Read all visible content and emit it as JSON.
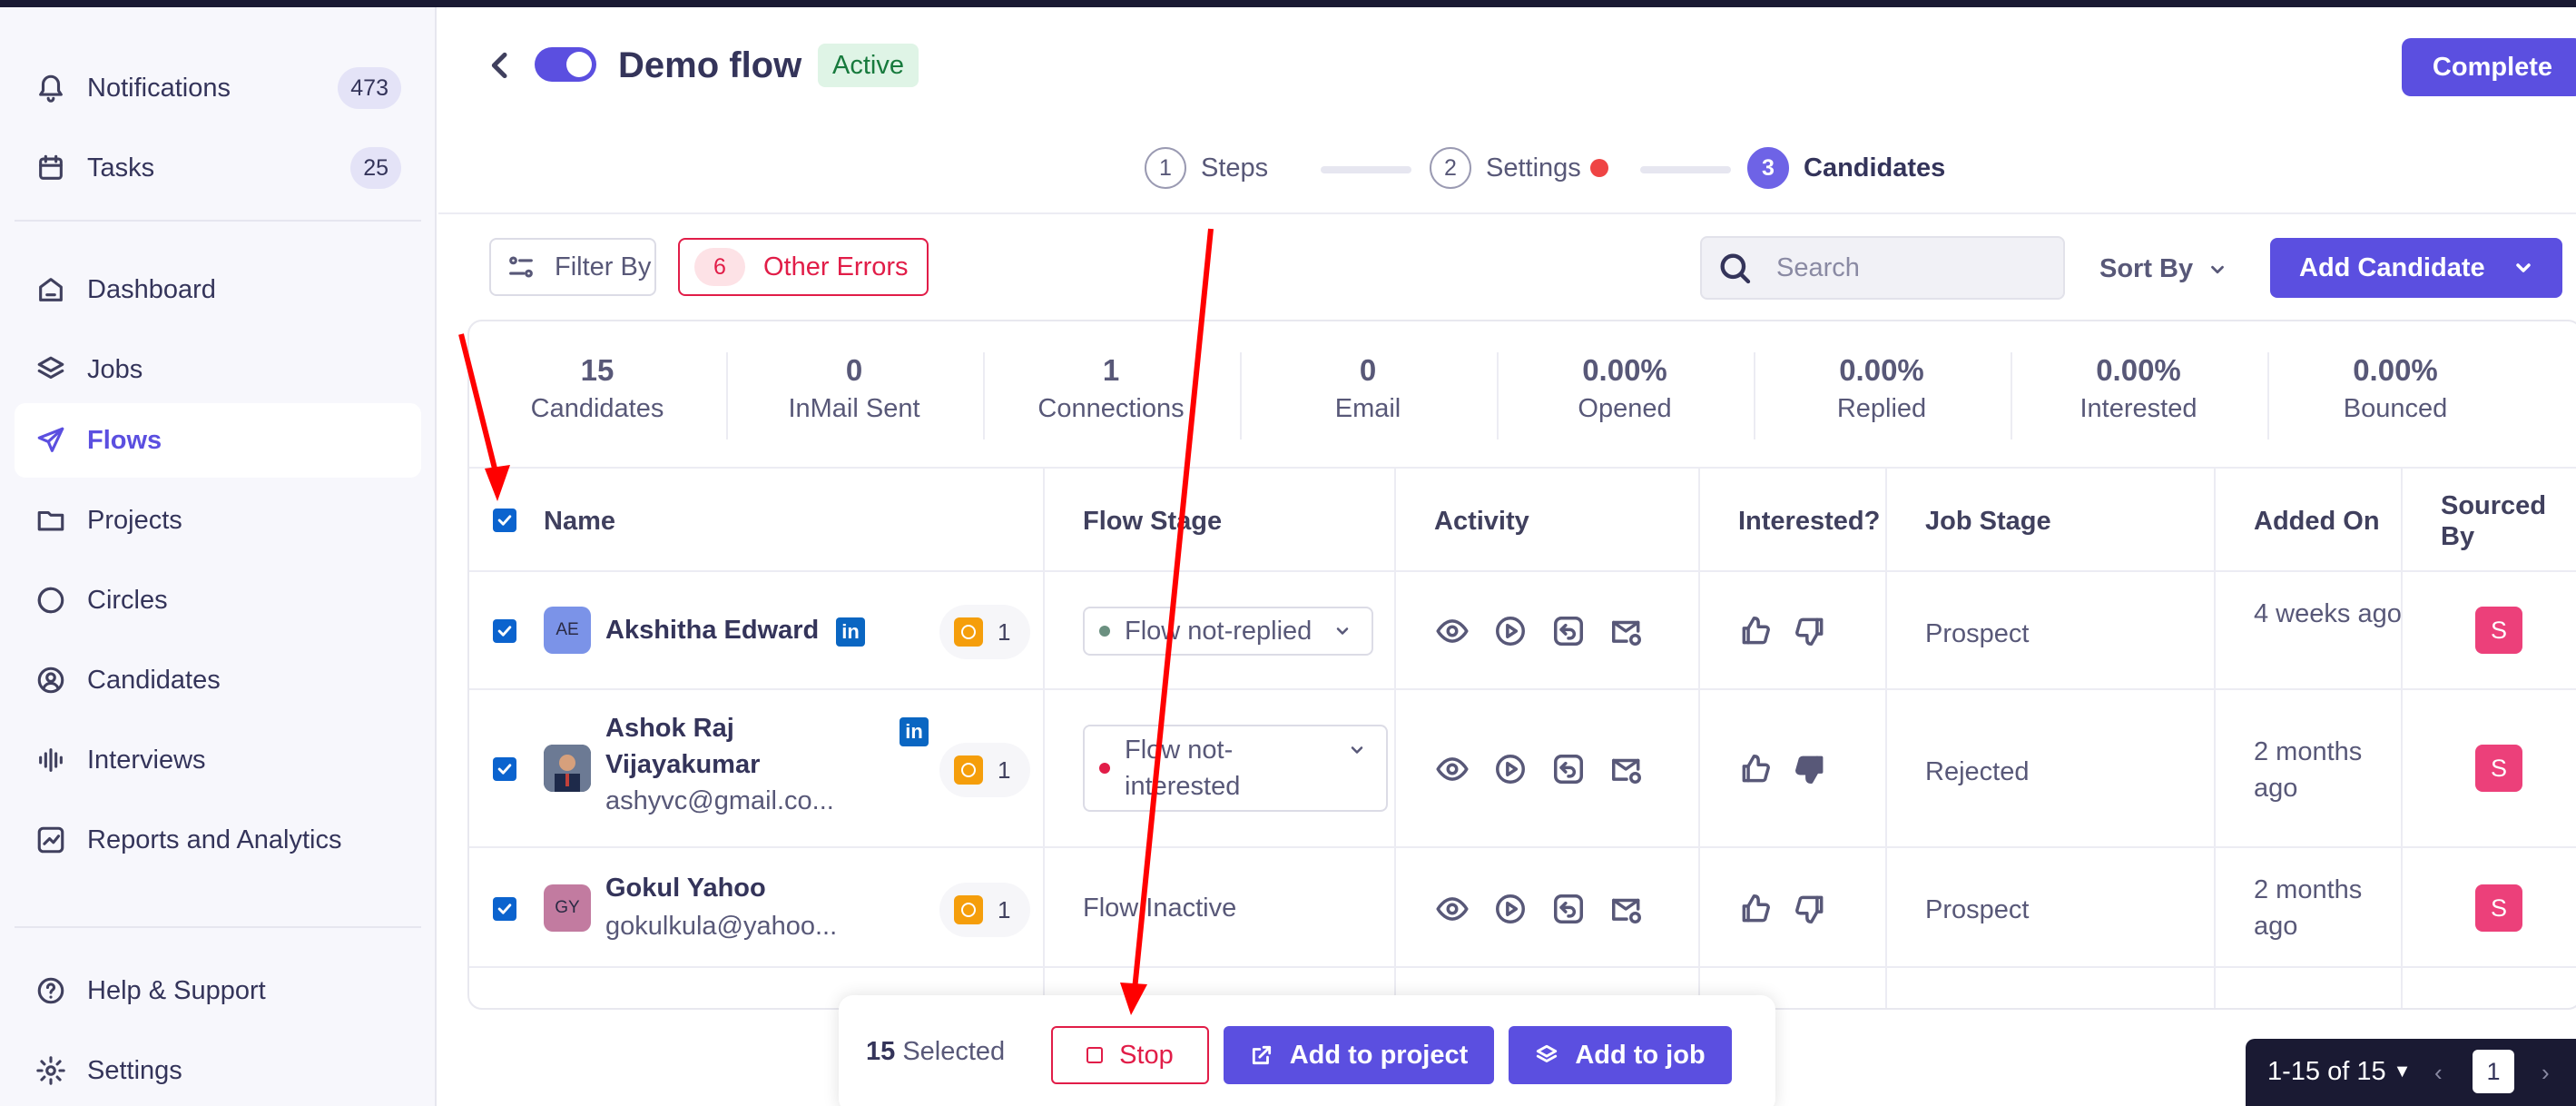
{
  "sidebar": {
    "items": [
      {
        "label": "Notifications",
        "badge": "473",
        "icon": "bell-icon"
      },
      {
        "label": "Tasks",
        "badge": "25",
        "icon": "calendar-icon"
      },
      {
        "label": "Dashboard",
        "icon": "home-icon"
      },
      {
        "label": "Jobs",
        "icon": "layers-icon"
      },
      {
        "label": "Flows",
        "icon": "send-icon",
        "active": true
      },
      {
        "label": "Projects",
        "icon": "folder-icon"
      },
      {
        "label": "Circles",
        "icon": "circles-icon"
      },
      {
        "label": "Candidates",
        "icon": "user-circle-icon"
      },
      {
        "label": "Interviews",
        "icon": "audio-wave-icon"
      },
      {
        "label": "Reports and Analytics",
        "icon": "chart-icon"
      },
      {
        "label": "Help & Support",
        "icon": "help-icon"
      },
      {
        "label": "Settings",
        "icon": "gear-icon"
      }
    ]
  },
  "header": {
    "title": "Demo flow",
    "status": "Active",
    "complete_label": "Complete"
  },
  "stepper": {
    "steps": [
      {
        "num": "1",
        "label": "Steps"
      },
      {
        "num": "2",
        "label": "Settings"
      },
      {
        "num": "3",
        "label": "Candidates"
      }
    ]
  },
  "toolbar": {
    "filter_label": "Filter By",
    "errors_count": "6",
    "errors_label": "Other Errors",
    "search_placeholder": "Search",
    "sort_label": "Sort By",
    "add_candidate_label": "Add Candidate"
  },
  "stats": [
    {
      "value": "15",
      "label": "Candidates"
    },
    {
      "value": "0",
      "label": "InMail Sent"
    },
    {
      "value": "1",
      "label": "Connections"
    },
    {
      "value": "0",
      "label": "Email"
    },
    {
      "value": "0.00%",
      "label": "Opened"
    },
    {
      "value": "0.00%",
      "label": "Replied"
    },
    {
      "value": "0.00%",
      "label": "Interested"
    },
    {
      "value": "0.00%",
      "label": "Bounced"
    }
  ],
  "table": {
    "columns": [
      "Name",
      "Flow Stage",
      "Activity",
      "Interested?",
      "Job Stage",
      "Added On",
      "Sourced By"
    ],
    "rows": [
      {
        "initials": "AE",
        "name": "Akshitha Edward",
        "email": "",
        "linkedin": "in",
        "seq_count": "1",
        "flow_stage": "Flow not-replied",
        "job_stage": "Prospect",
        "added_on": "4 weeks ago",
        "sourced_by": "S"
      },
      {
        "initials": "",
        "name": "Ashok Raj Vijayakumar",
        "email": "ashyvc@gmail.co...",
        "linkedin": "in",
        "seq_count": "1",
        "flow_stage": "Flow not-interested",
        "job_stage": "Rejected",
        "added_on": "2 months ago",
        "sourced_by": "S"
      },
      {
        "initials": "GY",
        "name": "Gokul Yahoo",
        "email": "gokulkula@yahoo...",
        "linkedin": "",
        "seq_count": "1",
        "flow_stage": "Flow Inactive",
        "job_stage": "Prospect",
        "added_on": "2 months ago",
        "sourced_by": "S"
      }
    ]
  },
  "action_bar": {
    "selected_count": "15",
    "selected_label": "Selected",
    "stop_label": "Stop",
    "add_project_label": "Add to project",
    "add_job_label": "Add to job"
  },
  "pagination": {
    "range": "1-15 of 15",
    "page": "1",
    "prev": "‹",
    "next": "›"
  },
  "colors": {
    "accent": "#5b4fe0",
    "error": "#e11d48",
    "annotation": "#ff0000"
  }
}
